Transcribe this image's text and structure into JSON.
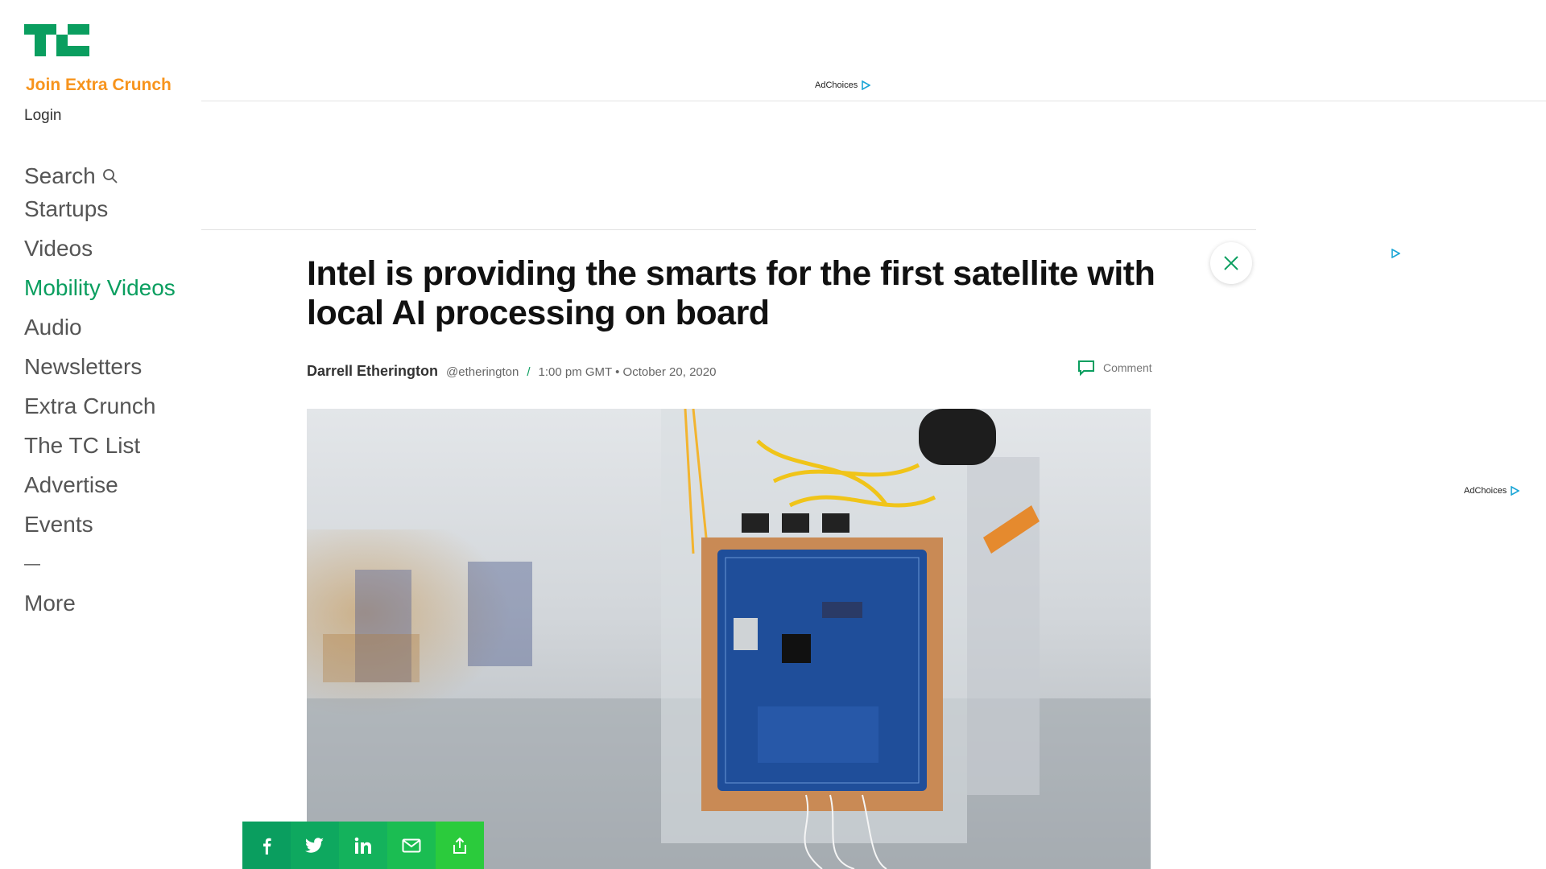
{
  "brand": {
    "logo_name": "TechCrunch",
    "accent": "#0a9e5f",
    "orange": "#f7941d"
  },
  "sidebar": {
    "join_label": "Join Extra Crunch",
    "login_label": "Login",
    "search_label": "Search",
    "items": [
      {
        "label": "Startups"
      },
      {
        "label": "Videos"
      },
      {
        "label": "Mobility Videos",
        "active": true
      },
      {
        "label": "Audio"
      },
      {
        "label": "Newsletters"
      },
      {
        "label": "Extra Crunch"
      },
      {
        "label": "The TC List"
      },
      {
        "label": "Advertise"
      },
      {
        "label": "Events"
      }
    ],
    "divider": "—",
    "more_label": "More"
  },
  "ads": {
    "adchoices_label": "AdChoices"
  },
  "article": {
    "title": "Intel is providing the smarts for the first satellite with local AI processing on board",
    "author": "Darrell Etherington",
    "handle": "@etherington",
    "separator": "/",
    "time": "1:00 pm GMT",
    "bullet": "•",
    "date": "October 20, 2020",
    "comment_label": "Comment"
  },
  "share": {
    "buttons": [
      {
        "name": "facebook",
        "color": "#0a9e5f"
      },
      {
        "name": "twitter",
        "color": "#0ea85f"
      },
      {
        "name": "linkedin",
        "color": "#14b25c"
      },
      {
        "name": "email",
        "color": "#1bbd52"
      },
      {
        "name": "share",
        "color": "#2bcb3c"
      }
    ]
  }
}
